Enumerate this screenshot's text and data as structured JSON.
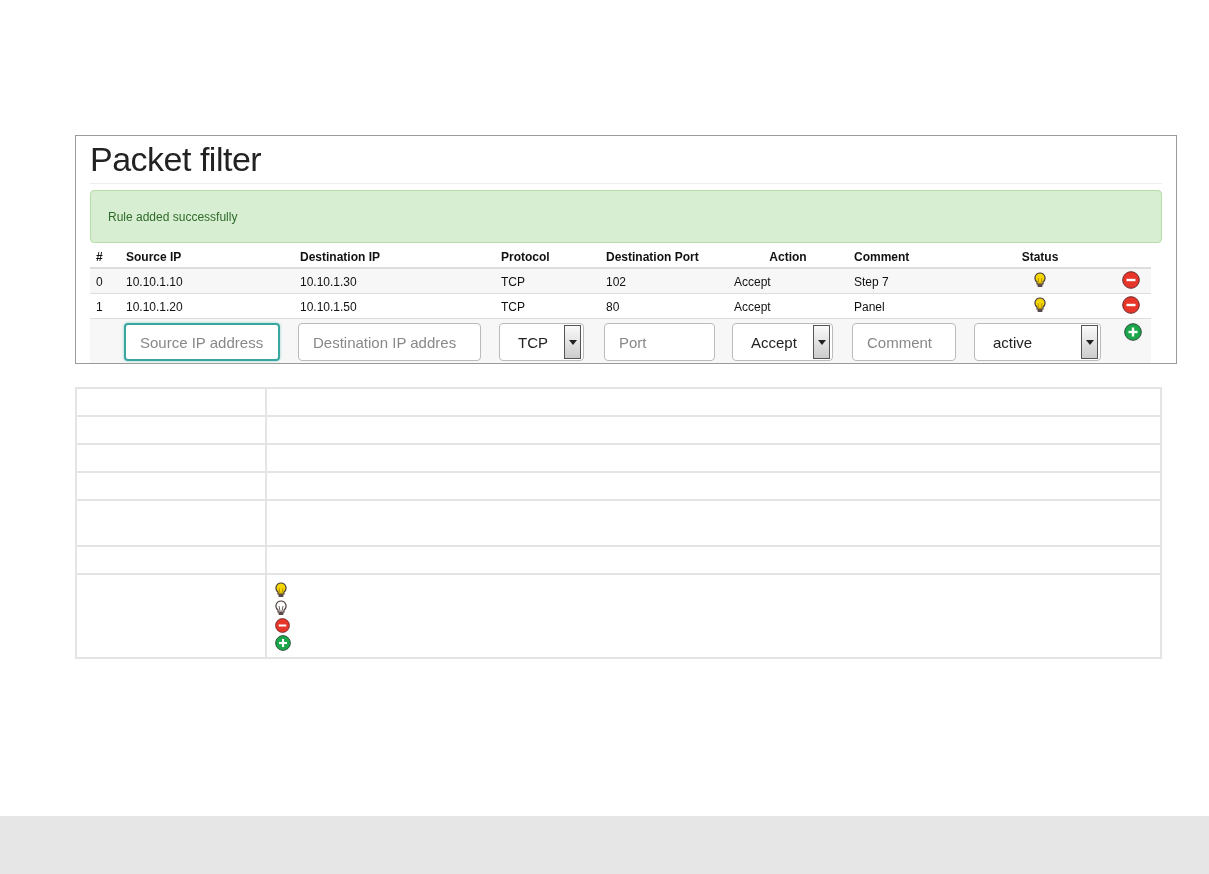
{
  "title": "Packet filter",
  "alert": {
    "text": "Rule added successfully"
  },
  "columns": [
    "#",
    "Source IP",
    "Destination IP",
    "Protocol",
    "Destination Port",
    "Action",
    "Comment",
    "Status"
  ],
  "rows": [
    {
      "index": "0",
      "source": "10.10.1.10",
      "destination": "10.10.1.30",
      "protocol": "TCP",
      "port": "102",
      "action": "Accept",
      "comment": "Step 7",
      "active": true
    },
    {
      "index": "1",
      "source": "10.10.1.20",
      "destination": "10.10.1.50",
      "protocol": "TCP",
      "port": "80",
      "action": "Accept",
      "comment": "Panel",
      "active": true
    }
  ],
  "form": {
    "source": {
      "placeholder": "Source IP address",
      "focused": true
    },
    "destination": {
      "placeholder": "Destination IP addres",
      "focused": false
    },
    "protocol": "TCP",
    "port": {
      "placeholder": "Port"
    },
    "action": "Accept",
    "comment": {
      "placeholder": "Comment"
    },
    "status": "active"
  }
}
